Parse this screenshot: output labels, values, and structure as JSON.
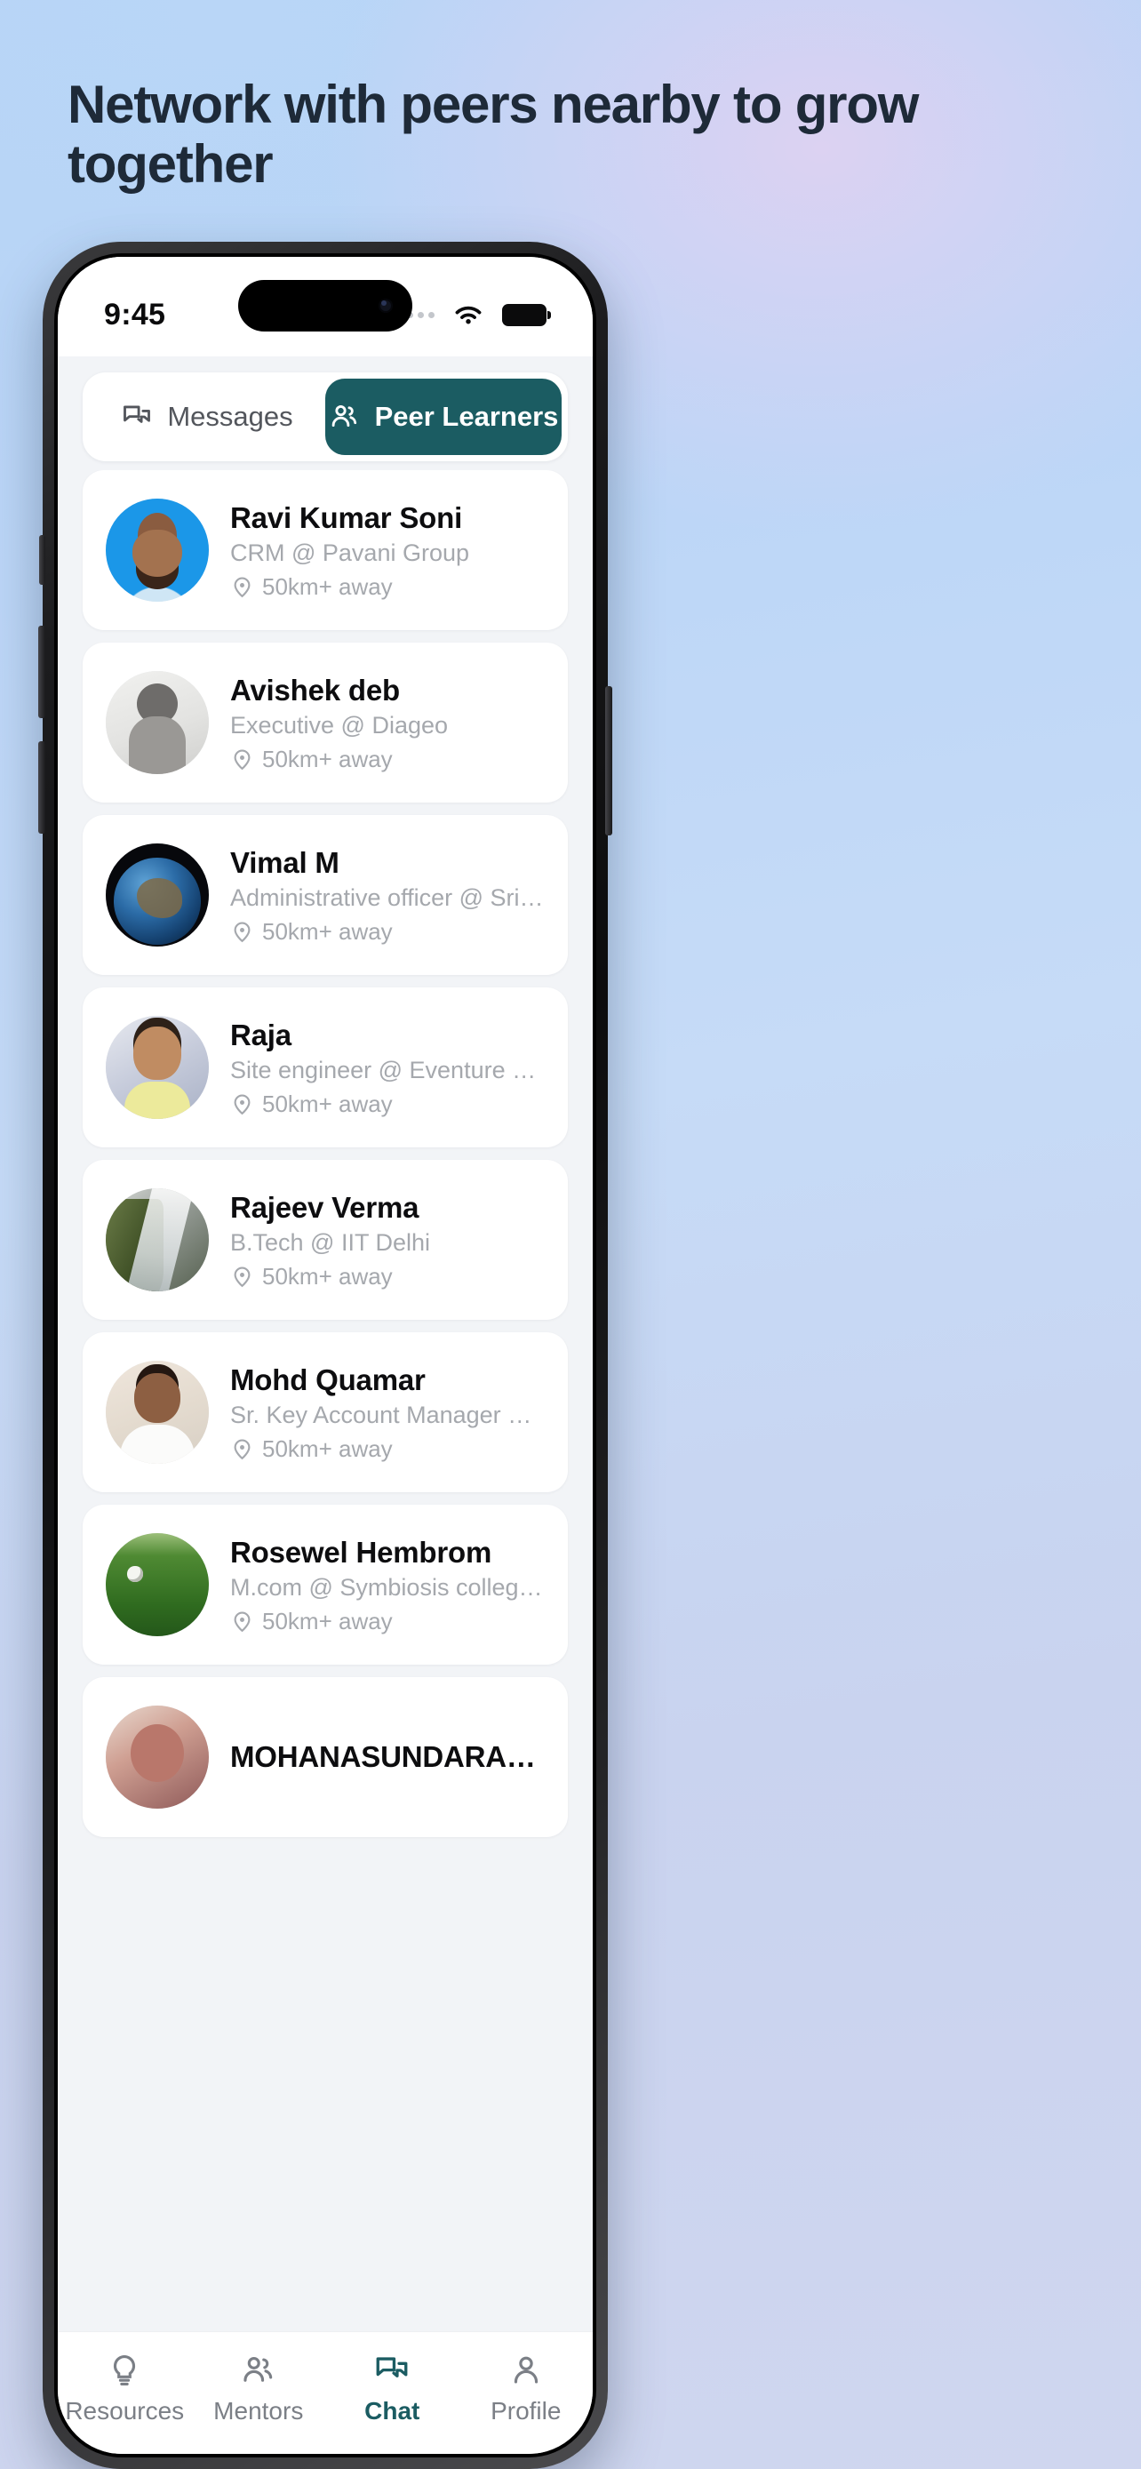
{
  "headline": "Network with peers nearby to grow together",
  "phone": {
    "status_bar": {
      "time": "9:45",
      "cellular_icon": "cellular-dots-icon",
      "wifi_icon": "wifi-icon",
      "battery_icon": "battery-icon"
    },
    "segmented_tabs": [
      {
        "label": "Messages",
        "icon": "chat-bubbles-icon",
        "active": false
      },
      {
        "label": "Peer Learners",
        "icon": "people-icon",
        "active": true
      }
    ],
    "people": [
      {
        "name": "Ravi Kumar Soni",
        "role": "CRM @ Pavani Group",
        "distance": "50km+ away",
        "avatar": "art-ravi"
      },
      {
        "name": "Avishek deb",
        "role": "Executive  @ Diageo",
        "distance": "50km+ away",
        "avatar": "art-avi"
      },
      {
        "name": "Vimal M",
        "role": "Administrative officer  @ Sri Chaitanya Techno…",
        "distance": "50km+ away",
        "avatar": "art-vimal"
      },
      {
        "name": "Raja",
        "role": "Site engineer @ Eventure softsol Pvt Ltd",
        "distance": "50km+ away",
        "avatar": "art-raja"
      },
      {
        "name": "Rajeev Verma",
        "role": "B.Tech @ IIT Delhi",
        "distance": "50km+ away",
        "avatar": "art-rajeev"
      },
      {
        "name": "Mohd Quamar",
        "role": "Sr. Key Account Manager @ Meesho",
        "distance": "50km+ away",
        "avatar": "art-mohd"
      },
      {
        "name": "Rosewel Hembrom",
        "role": "M.com @ Symbiosis college of arts and comme…",
        "distance": "50km+ away",
        "avatar": "art-rose"
      },
      {
        "name": "MOHANASUNDARAM R",
        "role": "",
        "distance": "",
        "avatar": "art-mohana"
      }
    ],
    "bottom_nav": [
      {
        "label": "Resources",
        "icon": "lightbulb-icon",
        "active": false
      },
      {
        "label": "Mentors",
        "icon": "people-icon",
        "active": false
      },
      {
        "label": "Chat",
        "icon": "chat-bubbles-icon",
        "active": true
      },
      {
        "label": "Profile",
        "icon": "person-icon",
        "active": false
      }
    ]
  },
  "colors": {
    "accent": "#1b5c62",
    "headline": "#1e2a38",
    "muted": "#a5a8ad",
    "nav_inactive": "#7b7f86"
  }
}
